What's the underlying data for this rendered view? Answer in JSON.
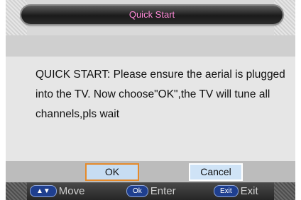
{
  "dialog": {
    "title": "Quick Start",
    "message": "QUICK START: Please ensure the aerial  is plugged\ninto the TV. Now   choose\"OK\",the TV will tune all\nchannels,pls wait"
  },
  "buttons": {
    "ok": "OK",
    "cancel": "Cancel"
  },
  "footer": {
    "move_key": "▲▼",
    "move_label": "Move",
    "enter_key": "Ok",
    "enter_label": "Enter",
    "exit_key": "Exit",
    "exit_label": "Exit"
  }
}
